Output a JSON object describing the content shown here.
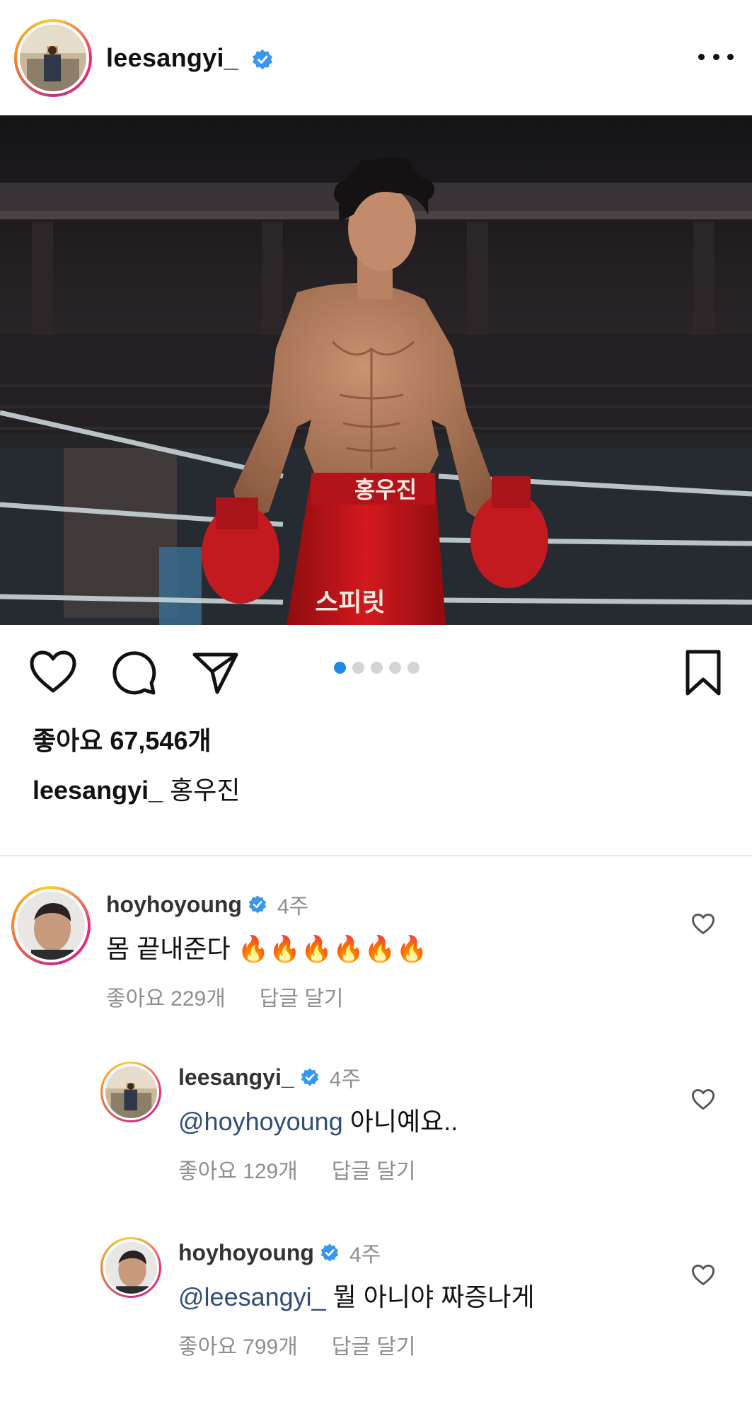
{
  "post": {
    "username": "leesangyi_",
    "likes_label": "좋아요 67,546개",
    "caption_user": "leesangyi_",
    "caption_text": "홍우진",
    "carousel_count": 5,
    "carousel_active": 0,
    "photo": {
      "trunks_text": "홍우진",
      "trunks_side_text": "스피릿"
    }
  },
  "icons": {
    "more": "more-options-icon",
    "like": "heart-icon",
    "comment": "comment-icon",
    "share": "paper-plane-icon",
    "save": "bookmark-icon",
    "verified": "verified-badge-icon"
  },
  "colors": {
    "verified": "#3897f0",
    "active_dot": "#1e88e5",
    "mention": "#2f4d79",
    "muted": "#8e8e8e"
  },
  "comments": [
    {
      "username": "hoyhoyoung",
      "time": "4주",
      "mention": "",
      "text": "몸 끝내준다 🔥🔥🔥🔥🔥🔥",
      "likes": "좋아요 229개",
      "reply": "답글 달기"
    },
    {
      "username": "leesangyi_",
      "time": "4주",
      "mention": "@hoyhoyoung",
      "text": " 아니예요..",
      "likes": "좋아요 129개",
      "reply": "답글 달기"
    },
    {
      "username": "hoyhoyoung",
      "time": "4주",
      "mention": "@leesangyi_",
      "text": " 뭘 아니야 짜증나게",
      "likes": "좋아요 799개",
      "reply": "답글 달기"
    }
  ]
}
